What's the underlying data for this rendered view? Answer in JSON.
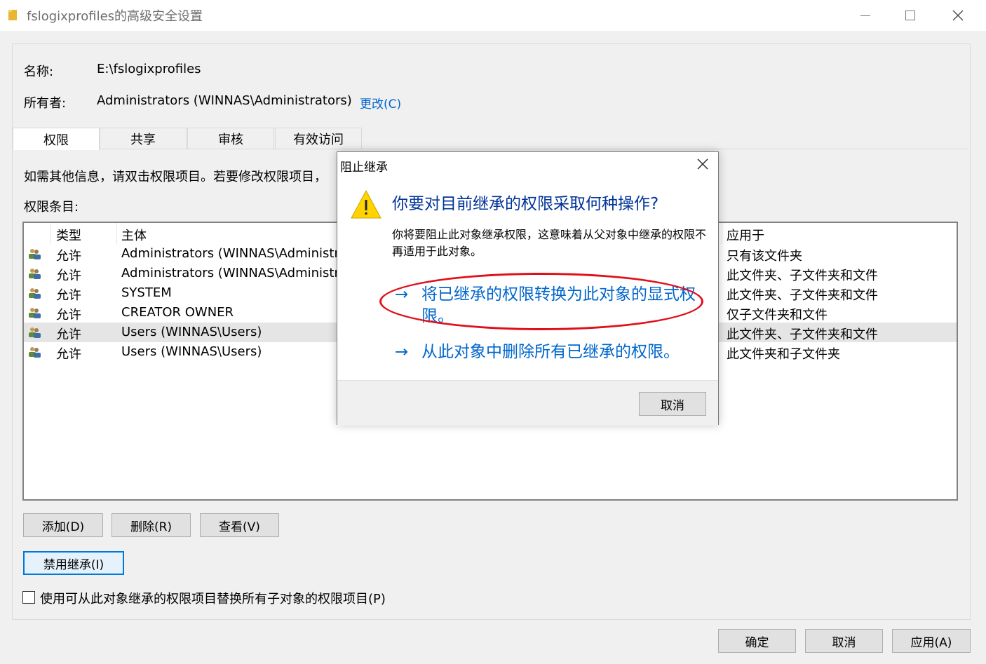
{
  "window": {
    "title": "fslogixprofiles的高级安全设置"
  },
  "info": {
    "name_label": "名称:",
    "name_value": "E:\\fslogixprofiles",
    "owner_label": "所有者:",
    "owner_value": "Administrators (WINNAS\\Administrators)",
    "change_link": "更改(C)"
  },
  "tabs": [
    "权限",
    "共享",
    "审核",
    "有效访问"
  ],
  "hint": "如需其他信息，请双击权限项目。若要修改权限项目，",
  "permission_entries_label": "权限条目:",
  "table": {
    "headers": [
      "类型",
      "主体",
      "应用于"
    ],
    "rows": [
      {
        "type": "允许",
        "principal": "Administrators (WINNAS\\Administr",
        "applies_to": "只有该文件夹"
      },
      {
        "type": "允许",
        "principal": "Administrators (WINNAS\\Administr",
        "applies_to": "此文件夹、子文件夹和文件"
      },
      {
        "type": "允许",
        "principal": "SYSTEM",
        "applies_to": "此文件夹、子文件夹和文件"
      },
      {
        "type": "允许",
        "principal": "CREATOR OWNER",
        "applies_to": "仅子文件夹和文件"
      },
      {
        "type": "允许",
        "principal": "Users (WINNAS\\Users)",
        "applies_to": "此文件夹、子文件夹和文件"
      },
      {
        "type": "允许",
        "principal": "Users (WINNAS\\Users)",
        "applies_to": "此文件夹和子文件夹"
      }
    ]
  },
  "buttons": {
    "add": "添加(D)",
    "remove": "删除(R)",
    "view": "查看(V)",
    "disable_inheritance": "禁用继承(I)",
    "ok": "确定",
    "cancel": "取消",
    "apply": "应用(A)"
  },
  "replace_checkbox_label": "使用可从此对象继承的权限项目替换所有子对象的权限项目(P)",
  "dialog": {
    "title": "阻止继承",
    "heading": "你要对目前继承的权限采取何种操作?",
    "description": "你将要阻止此对象继承权限，这意味着从父对象中继承的权限不再适用于此对象。",
    "option1": "将已继承的权限转换为此对象的显式权限。",
    "option2": "从此对象中删除所有已继承的权限。",
    "arrow": "→",
    "cancel": "取消"
  },
  "colors": {
    "link": "#0066cc",
    "heading": "#003399",
    "highlight_oval": "#e0101a",
    "selected_row": "#e5e5e5"
  }
}
